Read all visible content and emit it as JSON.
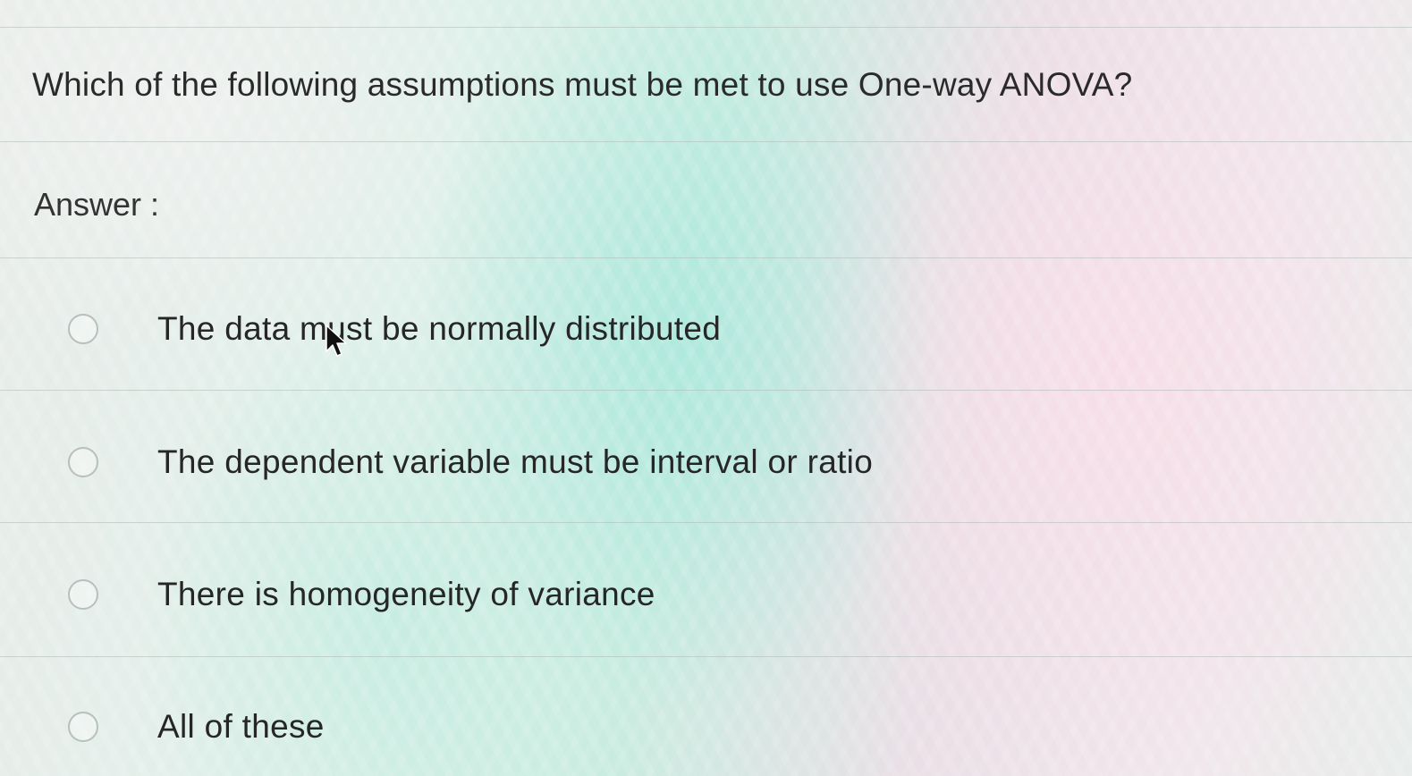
{
  "question": {
    "text": "Which of the following assumptions must be met to use One-way ANOVA?"
  },
  "answer_label": "Answer :",
  "options": [
    {
      "label": "The data must be normally distributed",
      "selected": false
    },
    {
      "label": "The dependent variable must be interval or ratio",
      "selected": false
    },
    {
      "label": "There is homogeneity of variance",
      "selected": false
    },
    {
      "label": "All of these",
      "selected": false
    }
  ],
  "cursor": {
    "icon": "mouse-pointer-icon"
  }
}
